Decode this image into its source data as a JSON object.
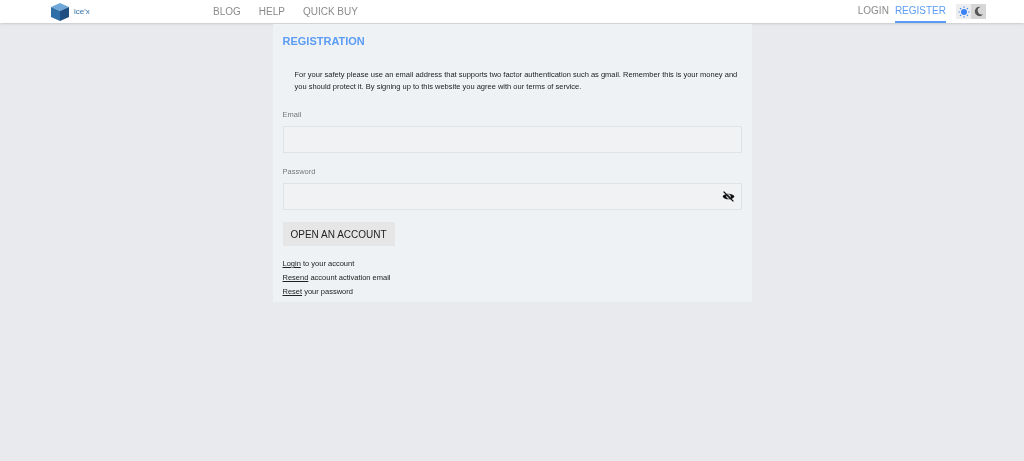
{
  "header": {
    "logo_text": "ice'x",
    "nav": [
      {
        "label": "BLOG",
        "selected": false
      },
      {
        "label": "HELP",
        "selected": false
      },
      {
        "label": "QUICK BUY",
        "selected": false
      }
    ],
    "auth": [
      {
        "label": "LOGIN",
        "selected": false
      },
      {
        "label": "REGISTER",
        "selected": true
      }
    ],
    "theme": [
      {
        "kind": "light",
        "selected": true
      },
      {
        "kind": "dark",
        "selected": false
      }
    ]
  },
  "form": {
    "title": "REGISTRATION",
    "notice": "For your safety please use an email address that supports two factor authentication such as gmail. Remember this is your money and you should protect it. By signing up to this website you agree with our terms of service.",
    "fields": [
      {
        "label": "Email",
        "kind": "text"
      },
      {
        "label": "Password",
        "kind": "password"
      }
    ],
    "submit": "OPEN AN ACCOUNT",
    "links": [
      {
        "link": "Login",
        "text": "to your account"
      },
      {
        "link": "Resend",
        "text": "account activation email"
      },
      {
        "link": "Reset",
        "text": "your password"
      }
    ]
  }
}
